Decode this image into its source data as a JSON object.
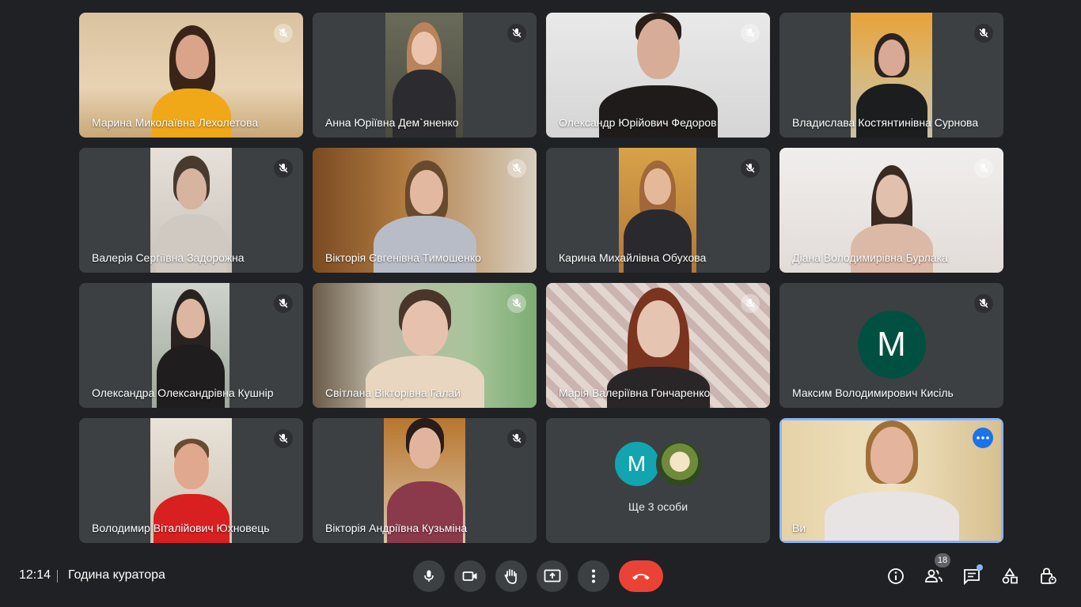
{
  "participants": [
    {
      "name": "Марина Миколаївна Лехолетова"
    },
    {
      "name": "Анна Юріївна Дем`яненко"
    },
    {
      "name": "Олександр Юрійович Федоров"
    },
    {
      "name": "Владислава Костянтинівна Сурнова"
    },
    {
      "name": "Валерія Сергіївна Задорожна"
    },
    {
      "name": "Вікторія Євгенівна Тимошенко"
    },
    {
      "name": "Карина Михайлівна Обухова"
    },
    {
      "name": "Діана Володимирівна Бурлака"
    },
    {
      "name": "Олександра Олександрівна Кушнір"
    },
    {
      "name": "Світлана Вікторівна Галай"
    },
    {
      "name": "Марія Валеріївна Гончаренко"
    },
    {
      "name": "Максим Володимирович Кисіль",
      "initial": "M",
      "avatar_color": "#005041"
    },
    {
      "name": "Володимир Віталійович Юхновець"
    },
    {
      "name": "Вікторія Андріївна Кузьміна"
    }
  ],
  "others_tile": {
    "initial": "M",
    "label": "Ще 3 особи"
  },
  "self_tile": {
    "name": "Ви"
  },
  "bottom_bar": {
    "time": "12:14",
    "meeting_title": "Година куратора",
    "participant_count": "18"
  },
  "colors": {
    "background": "#202124",
    "tile": "#3c4043",
    "hangup": "#ea4335",
    "accent": "#1a73e8"
  }
}
